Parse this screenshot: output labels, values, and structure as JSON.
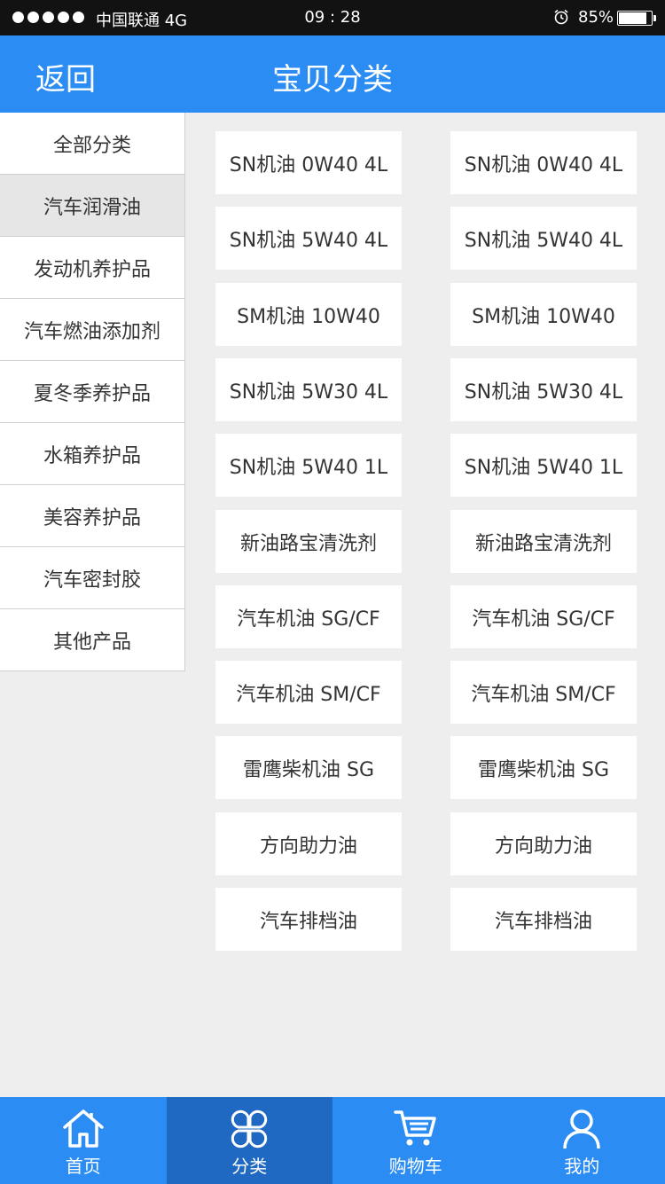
{
  "status_bar": {
    "carrier": "中国联通 4G",
    "time": "09 : 28",
    "battery": "85%",
    "battery_level": 0.85
  },
  "nav": {
    "back_label": "返回",
    "title": "宝贝分类"
  },
  "sidebar": {
    "items": [
      {
        "label": "全部分类",
        "active": false
      },
      {
        "label": "汽车润滑油",
        "active": true
      },
      {
        "label": "发动机养护品",
        "active": false
      },
      {
        "label": "汽车燃油添加剂",
        "active": false
      },
      {
        "label": "夏冬季养护品",
        "active": false
      },
      {
        "label": "水箱养护品",
        "active": false
      },
      {
        "label": "美容养护品",
        "active": false
      },
      {
        "label": "汽车密封胶",
        "active": false
      },
      {
        "label": "其他产品",
        "active": false
      }
    ]
  },
  "products": [
    {
      "left": "SN机油 0W40 4L",
      "right": "SN机油 0W40 4L"
    },
    {
      "left": "SN机油 5W40 4L",
      "right": "SN机油 5W40 4L"
    },
    {
      "left": "SM机油 10W40",
      "right": "SM机油 10W40"
    },
    {
      "left": "SN机油 5W30 4L",
      "right": "SN机油 5W30 4L"
    },
    {
      "left": "SN机油 5W40 1L",
      "right": "SN机油 5W40 1L"
    },
    {
      "left": "新油路宝清洗剂",
      "right": "新油路宝清洗剂"
    },
    {
      "left": "汽车机油 SG/CF",
      "right": "汽车机油 SG/CF"
    },
    {
      "left": "汽车机油 SM/CF",
      "right": "汽车机油 SM/CF"
    },
    {
      "left": "雷鹰柴机油 SG",
      "right": "雷鹰柴机油 SG"
    },
    {
      "left": "方向助力油",
      "right": "方向助力油"
    },
    {
      "left": "汽车排档油",
      "right": "汽车排档油"
    }
  ],
  "tab_bar": {
    "tabs": [
      {
        "label": "首页",
        "icon": "home-icon",
        "active": false
      },
      {
        "label": "分类",
        "icon": "category-icon",
        "active": true
      },
      {
        "label": "购物车",
        "icon": "cart-icon",
        "active": false
      },
      {
        "label": "我的",
        "icon": "user-icon",
        "active": false
      }
    ]
  },
  "colors": {
    "primary": "#2b8cf4",
    "tab_active": "#1f69c2",
    "background": "#eeeeee",
    "status_bar": "#121212"
  }
}
